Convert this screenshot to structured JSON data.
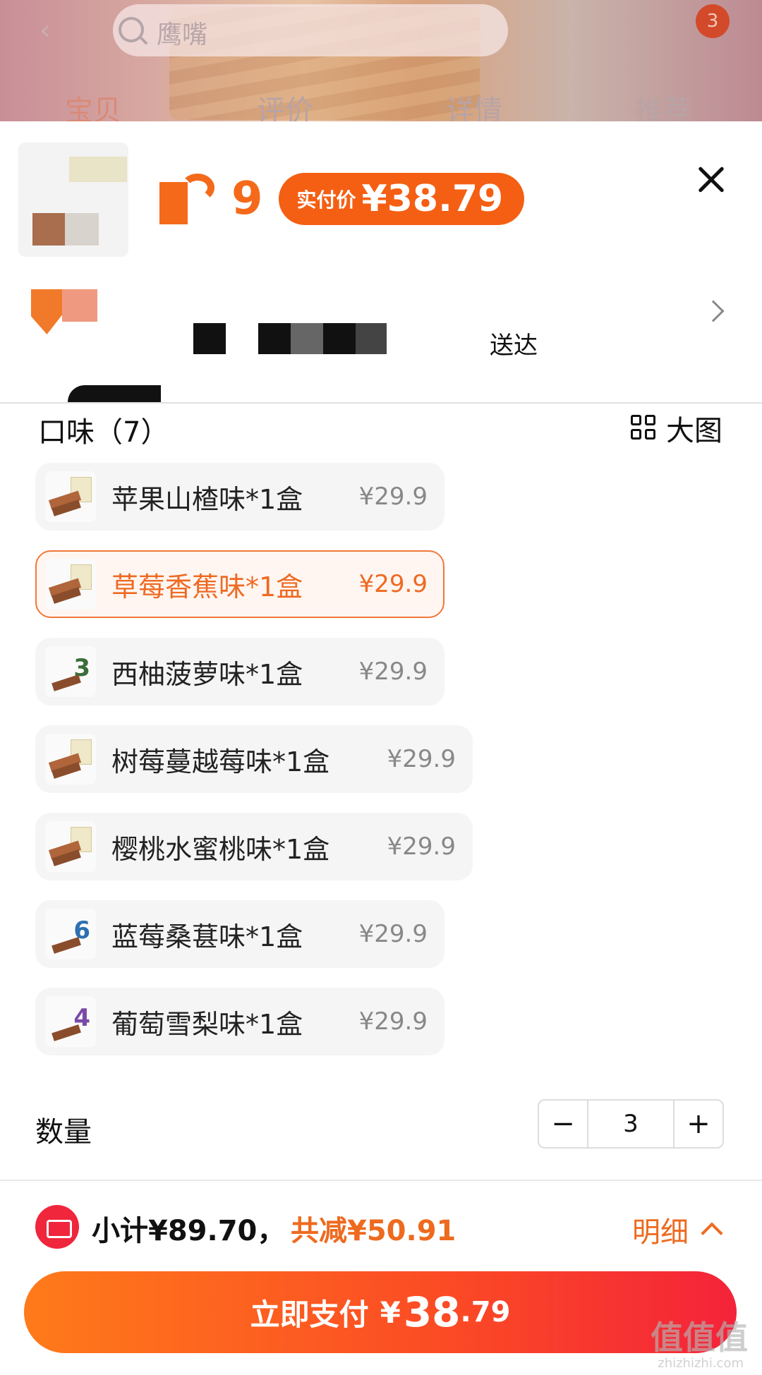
{
  "header": {
    "search_placeholder": "鹰嘴",
    "cart_count": "3",
    "tabs": [
      "宝贝",
      "评价",
      "详情",
      "推荐"
    ]
  },
  "sheet": {
    "price_digit": "9",
    "pay_label": "实付价",
    "pay_amount": "¥38.79",
    "shipping_text": "送达"
  },
  "options": {
    "section_label": "口味（7）",
    "big_picture_label": "大图",
    "items": [
      {
        "name": "苹果山楂味*1盒",
        "price": "¥29.9",
        "selected": false
      },
      {
        "name": "草莓香蕉味*1盒",
        "price": "¥29.9",
        "selected": true
      },
      {
        "name": "西柚菠萝味*1盒",
        "price": "¥29.9",
        "selected": false
      },
      {
        "name": "树莓蔓越莓味*1盒",
        "price": "¥29.9",
        "selected": false
      },
      {
        "name": "樱桃水蜜桃味*1盒",
        "price": "¥29.9",
        "selected": false
      },
      {
        "name": "蓝莓桑葚味*1盒",
        "price": "¥29.9",
        "selected": false
      },
      {
        "name": "葡萄雪梨味*1盒",
        "price": "¥29.9",
        "selected": false
      }
    ],
    "quantity_label": "数量",
    "quantity_value": "3",
    "minus": "−",
    "plus": "+"
  },
  "footer": {
    "subtotal": "小计¥89.70，",
    "saved": "共减¥50.91",
    "detail_label": "明细",
    "pay_button_label": "立即支付",
    "pay_currency": "¥",
    "pay_integer": "38",
    "pay_decimal": ".79",
    "watermark": "值值值",
    "watermark_sub": "zhizhizhi.com"
  },
  "colors": {
    "accent": "#f46a1a",
    "selected_border": "#f2773a",
    "coupon_red": "#f0263c"
  }
}
